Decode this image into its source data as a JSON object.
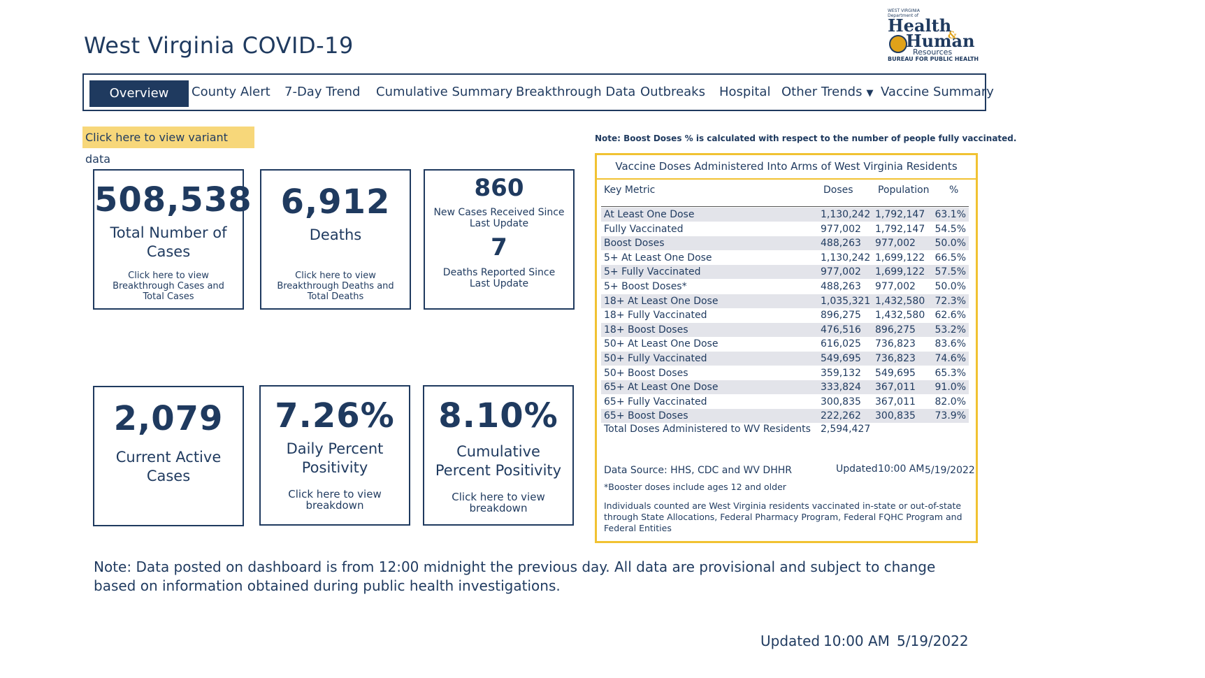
{
  "page_title": "West Virginia COVID-19",
  "logo": {
    "line1": "WEST VIRGINIA",
    "line2": "Department of",
    "health": "Health",
    "amp": "&",
    "human": "Human",
    "resources": "Resources",
    "bureau": "BUREAU FOR PUBLIC HEALTH"
  },
  "nav": {
    "tabs": [
      "Overview",
      "County Alert",
      "7-Day Trend",
      "Cumulative Summary",
      "Breakthrough Data",
      "Outbreaks",
      "Hospital",
      "Other Trends",
      "Vaccine Summary"
    ],
    "caret": "▼"
  },
  "variant_link": "Click here to view variant data",
  "cards": {
    "total_cases": {
      "value": "508,538",
      "label": "Total Number of Cases",
      "link": "Click here to view Breakthrough Cases and Total Cases"
    },
    "deaths": {
      "value": "6,912",
      "label": "Deaths",
      "link": "Click here to view Breakthrough Deaths and Total Deaths"
    },
    "new_since": {
      "new_cases": "860",
      "new_cases_label": "New Cases Received Since Last Update",
      "new_deaths": "7",
      "new_deaths_label": "Deaths Reported Since Last Update"
    },
    "active": {
      "value": "2,079",
      "label": "Current Active Cases"
    },
    "daily": {
      "value": "7.26%",
      "label": "Daily Percent Positivity",
      "link": "Click here to view breakdown"
    },
    "cumulative": {
      "value": "8.10%",
      "label": "Cumulative Percent Positivity",
      "link": "Click here to view breakdown"
    }
  },
  "vaccine": {
    "note": "Note: Boost Doses % is calculated with respect to the number of people fully vaccinated.",
    "title": "Vaccine Doses Administered Into Arms of West Virginia Residents",
    "headers": [
      "Key Metric",
      "Doses",
      "Population",
      "%"
    ],
    "rows": [
      [
        "At Least One Dose",
        "1,130,242",
        "1,792,147",
        "63.1%"
      ],
      [
        "Fully Vaccinated",
        "977,002",
        "1,792,147",
        "54.5%"
      ],
      [
        "Boost Doses",
        "488,263",
        "977,002",
        "50.0%"
      ],
      [
        "5+ At Least One Dose",
        "1,130,242",
        "1,699,122",
        "66.5%"
      ],
      [
        "5+ Fully Vaccinated",
        "977,002",
        "1,699,122",
        "57.5%"
      ],
      [
        "5+ Boost Doses*",
        "488,263",
        "977,002",
        "50.0%"
      ],
      [
        "18+ At Least One Dose",
        "1,035,321",
        "1,432,580",
        "72.3%"
      ],
      [
        "18+ Fully Vaccinated",
        "896,275",
        "1,432,580",
        "62.6%"
      ],
      [
        "18+ Boost Doses",
        "476,516",
        "896,275",
        "53.2%"
      ],
      [
        "50+ At Least One Dose",
        "616,025",
        "736,823",
        "83.6%"
      ],
      [
        "50+ Fully Vaccinated",
        "549,695",
        "736,823",
        "74.6%"
      ],
      [
        "50+ Boost Doses",
        "359,132",
        "549,695",
        "65.3%"
      ],
      [
        "65+ At Least One Dose",
        "333,824",
        "367,011",
        "91.0%"
      ],
      [
        "65+ Fully Vaccinated",
        "300,835",
        "367,011",
        "82.0%"
      ],
      [
        "65+ Boost Doses",
        "222,262",
        "300,835",
        "73.9%"
      ]
    ],
    "total_label": "Total Doses Administered to WV Residents",
    "total_value": "2,594,427",
    "source": "Data Source: HHS, CDC and WV DHHR",
    "updated_label": "Updated",
    "updated_time": "10:00 AM",
    "updated_date": "5/19/2022",
    "booster_note": "*Booster doses include ages 12 and older",
    "individuals_note": "Individuals counted are West Virginia residents vaccinated in-state or out-of-state through State Allocations, Federal Pharmacy Program, Federal FQHC Program and Federal Entities"
  },
  "bottom_note": "Note: Data posted on dashboard is from 12:00 midnight the previous day. All data are provisional and subject to change based on information obtained during public health investigations.",
  "footer_updated": {
    "label": "Updated",
    "time": "10:00 AM",
    "date": "5/19/2022"
  }
}
